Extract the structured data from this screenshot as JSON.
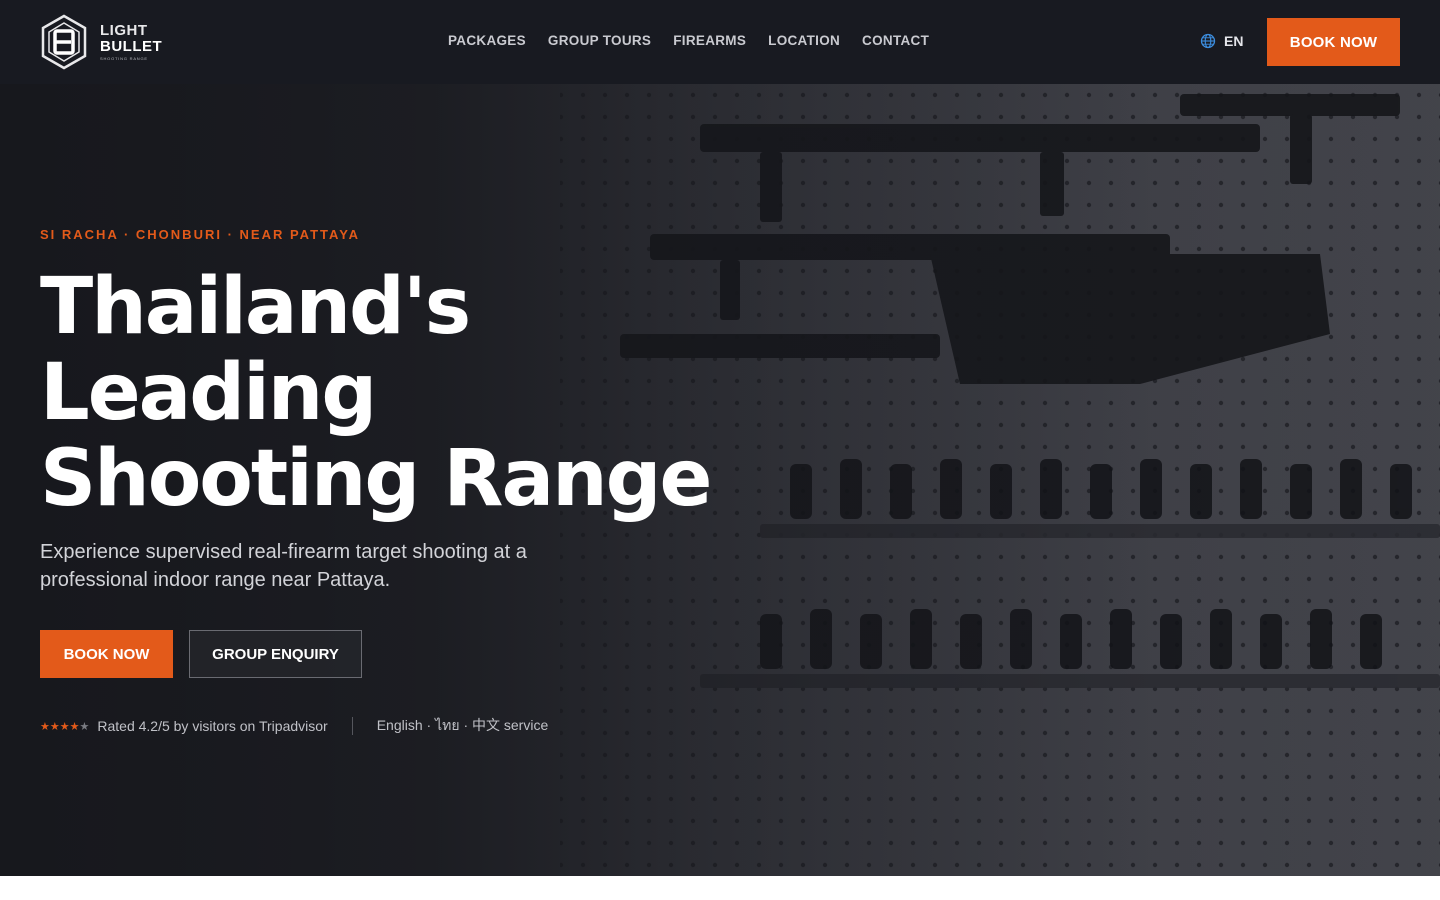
{
  "brand": {
    "line1": "LIGHT",
    "line2": "BULLET",
    "line3": "SHOOTING RANGE"
  },
  "nav": {
    "items": [
      {
        "label": "PACKAGES"
      },
      {
        "label": "GROUP TOURS"
      },
      {
        "label": "FIREARMS"
      },
      {
        "label": "LOCATION"
      },
      {
        "label": "CONTACT"
      }
    ]
  },
  "language": {
    "code": "EN",
    "icon": "globe-icon"
  },
  "header": {
    "cta_label": "BOOK NOW"
  },
  "hero": {
    "eyebrow": "SI RACHA · CHONBURI · NEAR PATTAYA",
    "title_lines": [
      "Thailand's",
      "Leading",
      "Shooting Range"
    ],
    "subtitle": "Experience supervised real-firearm target shooting at a professional indoor range near Pattaya.",
    "primary_cta": "BOOK NOW",
    "secondary_cta": "GROUP ENQUIRY",
    "rating": {
      "value": 4.2,
      "max": 5,
      "stars_filled": 4,
      "text": "Rated 4.2/5 by visitors on Tripadvisor"
    },
    "languages_text": "English · ไทย · 中文 service"
  },
  "colors": {
    "accent": "#e35a1a",
    "header_bg": "#181a21",
    "hero_dark": "#17181d"
  }
}
